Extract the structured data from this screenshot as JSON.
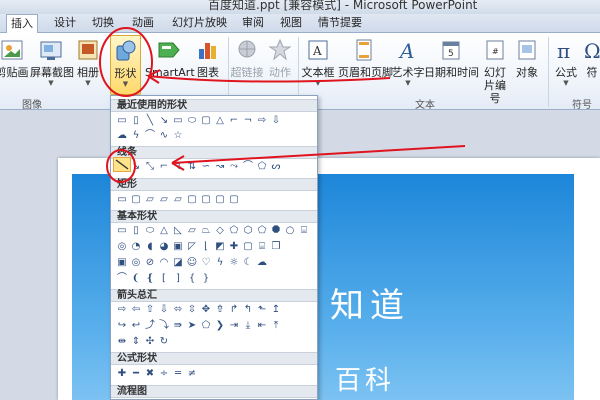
{
  "window": {
    "title": "百度知道.ppt [兼容模式] - Microsoft PowerPoint"
  },
  "tabs": [
    {
      "label": "插入",
      "active": true
    },
    {
      "label": "设计"
    },
    {
      "label": "切换"
    },
    {
      "label": "动画"
    },
    {
      "label": "幻灯片放映"
    },
    {
      "label": "审阅"
    },
    {
      "label": "视图"
    },
    {
      "label": "情节提要"
    }
  ],
  "ribbon": {
    "clipart": "剪贴画",
    "screenshot": "屏幕截图",
    "album": "相册",
    "shapes": "形状",
    "smartart": "SmartArt",
    "chart": "图表",
    "hyperlink": "超链接",
    "action": "动作",
    "textbox": "文本框",
    "header_footer": "页眉和页脚",
    "wordart": "艺术字",
    "datetime": "日期和时间",
    "slide_number": "幻灯\n片编号",
    "object": "对象",
    "equation": "公式",
    "symbol": "符",
    "groups": {
      "images": "图像",
      "text": "文本",
      "symbols": "符号"
    }
  },
  "gallery": {
    "sections": {
      "recent": "最近使用的形状",
      "lines": "线条",
      "rectangles": "矩形",
      "basic": "基本形状",
      "arrows": "箭头总汇",
      "equation": "公式形状",
      "flowchart": "流程图"
    }
  },
  "slide": {
    "title": "知道",
    "subtitle": "百科"
  },
  "colors": {
    "accent_red": "#e0141e",
    "slide_blue": "#1d86d9",
    "highlight": "#ffd96b"
  }
}
